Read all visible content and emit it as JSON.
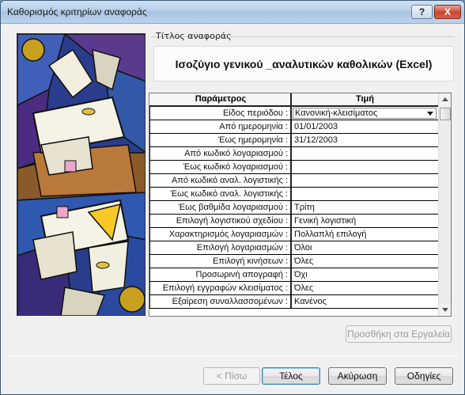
{
  "window": {
    "title": "Καθορισμός κριτηρίων αναφοράς",
    "help_label": "?",
    "close_label": "X"
  },
  "report_group": {
    "label": "Τίτλος αναφοράς",
    "title": "Ισοζύγιο γενικού _αναλυτικών καθολικών (Excel)"
  },
  "grid": {
    "columns": [
      "Παράμετρος",
      "Τιμή"
    ],
    "rows": [
      {
        "param": "Είδος περιόδου :",
        "value": "Κανονική-κλεισίματος",
        "dropdown": true
      },
      {
        "param": "Από ημερομηνία :",
        "value": "01/01/2003"
      },
      {
        "param": "Έως ημερομηνία :",
        "value": "31/12/2003"
      },
      {
        "param": "Από κωδικό λογαριασμού :",
        "value": ""
      },
      {
        "param": "Έως κωδικό λογαριασμού :",
        "value": ""
      },
      {
        "param": "Από κωδικό αναλ. λογιστικής :",
        "value": ""
      },
      {
        "param": "Έως κωδικό αναλ. λογιστικής :",
        "value": ""
      },
      {
        "param": "Έως βαθμίδα λογαριασμού :",
        "value": "Τρίτη"
      },
      {
        "param": "Επιλογή λογιστικού σχεδίου :",
        "value": "Γενική λογιστική"
      },
      {
        "param": "Χαρακτηρισμός λογαριασμών :",
        "value": "Πολλαπλή επιλογή"
      },
      {
        "param": "Επιλογή λογαριασμών :",
        "value": "Όλοι"
      },
      {
        "param": "Επιλογή κινήσεων :",
        "value": "Όλες"
      },
      {
        "param": "Προσωρινή απογραφή :",
        "value": "Όχι"
      },
      {
        "param": "Επιλογή εγγραφών κλεισίματος :",
        "value": "Όλες"
      },
      {
        "param": "Εξαίρεση συναλλασσομένων :",
        "value": "Κανένος"
      }
    ]
  },
  "buttons": {
    "add_tools": "Προσθήκη στα Εργαλεία",
    "back": "< Πίσω",
    "finish": "Τέλος",
    "cancel": "Ακύρωση",
    "help": "Οδηγίες"
  }
}
